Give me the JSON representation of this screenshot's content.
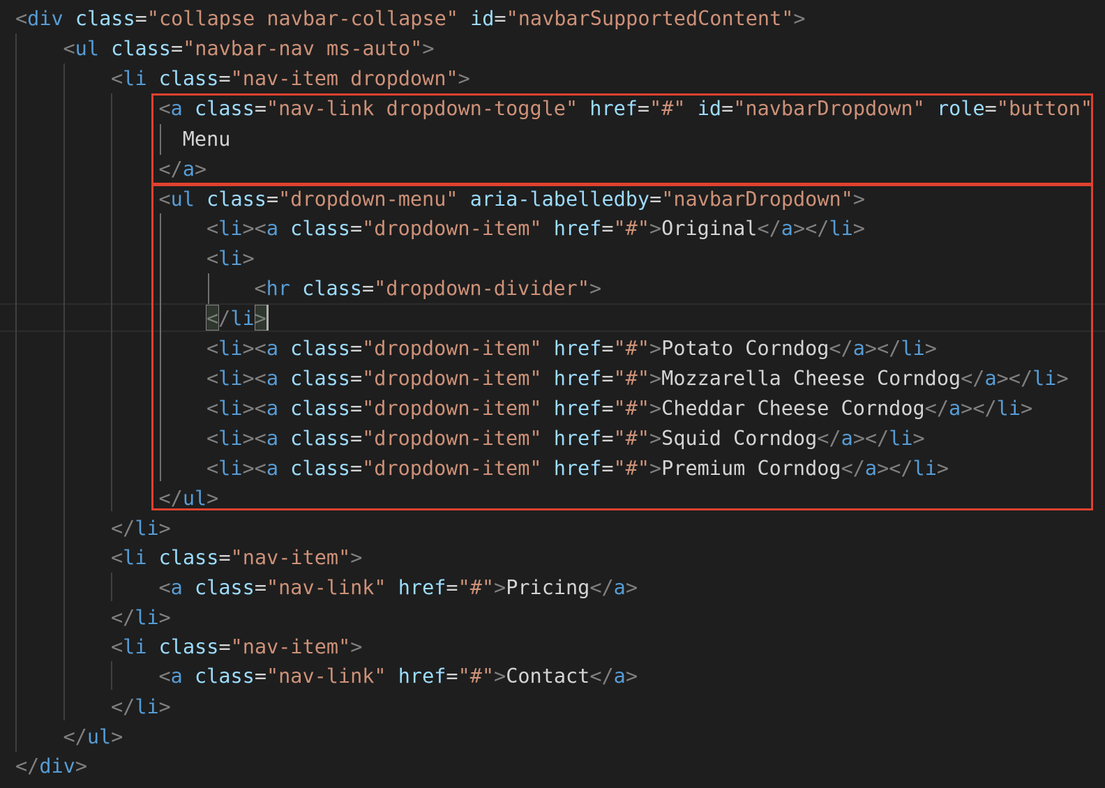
{
  "code": {
    "lines": [
      [
        [
          "p",
          "<"
        ],
        [
          "tg",
          "div"
        ],
        [
          "tx",
          " "
        ],
        [
          "at",
          "class"
        ],
        [
          "tx",
          "="
        ],
        [
          "st",
          "\"collapse navbar-collapse\""
        ],
        [
          "tx",
          " "
        ],
        [
          "at",
          "id"
        ],
        [
          "tx",
          "="
        ],
        [
          "st",
          "\"navbarSupportedContent\""
        ],
        [
          "p",
          ">"
        ]
      ],
      [
        [
          "p",
          "<"
        ],
        [
          "tg",
          "ul"
        ],
        [
          "tx",
          " "
        ],
        [
          "at",
          "class"
        ],
        [
          "tx",
          "="
        ],
        [
          "st",
          "\"navbar-nav ms-auto\""
        ],
        [
          "p",
          ">"
        ]
      ],
      [
        [
          "p",
          "<"
        ],
        [
          "tg",
          "li"
        ],
        [
          "tx",
          " "
        ],
        [
          "at",
          "class"
        ],
        [
          "tx",
          "="
        ],
        [
          "st",
          "\"nav-item dropdown\""
        ],
        [
          "p",
          ">"
        ]
      ],
      [
        [
          "p",
          "<"
        ],
        [
          "tg",
          "a"
        ],
        [
          "tx",
          " "
        ],
        [
          "at",
          "class"
        ],
        [
          "tx",
          "="
        ],
        [
          "st",
          "\"nav-link dropdown-toggle\""
        ],
        [
          "tx",
          " "
        ],
        [
          "at",
          "href"
        ],
        [
          "tx",
          "="
        ],
        [
          "st",
          "\"#\""
        ],
        [
          "tx",
          " "
        ],
        [
          "at",
          "id"
        ],
        [
          "tx",
          "="
        ],
        [
          "st",
          "\"navbarDropdown\""
        ],
        [
          "tx",
          " "
        ],
        [
          "at",
          "role"
        ],
        [
          "tx",
          "="
        ],
        [
          "st",
          "\"button\""
        ]
      ],
      [
        [
          "tx",
          "Menu"
        ]
      ],
      [
        [
          "p",
          "</"
        ],
        [
          "tg",
          "a"
        ],
        [
          "p",
          ">"
        ]
      ],
      [
        [
          "p",
          "<"
        ],
        [
          "tg",
          "ul"
        ],
        [
          "tx",
          " "
        ],
        [
          "at",
          "class"
        ],
        [
          "tx",
          "="
        ],
        [
          "st",
          "\"dropdown-menu\""
        ],
        [
          "tx",
          " "
        ],
        [
          "at",
          "aria-labelledby"
        ],
        [
          "tx",
          "="
        ],
        [
          "st",
          "\"navbarDropdown\""
        ],
        [
          "p",
          ">"
        ]
      ],
      [
        [
          "p",
          "<"
        ],
        [
          "tg",
          "li"
        ],
        [
          "p",
          "><"
        ],
        [
          "tg",
          "a"
        ],
        [
          "tx",
          " "
        ],
        [
          "at",
          "class"
        ],
        [
          "tx",
          "="
        ],
        [
          "st",
          "\"dropdown-item\""
        ],
        [
          "tx",
          " "
        ],
        [
          "at",
          "href"
        ],
        [
          "tx",
          "="
        ],
        [
          "st",
          "\"#\""
        ],
        [
          "p",
          ">"
        ],
        [
          "tx",
          "Original"
        ],
        [
          "p",
          "</"
        ],
        [
          "tg",
          "a"
        ],
        [
          "p",
          "></"
        ],
        [
          "tg",
          "li"
        ],
        [
          "p",
          ">"
        ]
      ],
      [
        [
          "p",
          "<"
        ],
        [
          "tg",
          "li"
        ],
        [
          "p",
          ">"
        ]
      ],
      [
        [
          "p",
          "<"
        ],
        [
          "tg",
          "hr"
        ],
        [
          "tx",
          " "
        ],
        [
          "at",
          "class"
        ],
        [
          "tx",
          "="
        ],
        [
          "st",
          "\"dropdown-divider\""
        ],
        [
          "p",
          ">"
        ]
      ],
      [
        [
          "p",
          "</"
        ],
        [
          "tg",
          "li"
        ],
        [
          "p",
          ">"
        ]
      ],
      [
        [
          "p",
          "<"
        ],
        [
          "tg",
          "li"
        ],
        [
          "p",
          "><"
        ],
        [
          "tg",
          "a"
        ],
        [
          "tx",
          " "
        ],
        [
          "at",
          "class"
        ],
        [
          "tx",
          "="
        ],
        [
          "st",
          "\"dropdown-item\""
        ],
        [
          "tx",
          " "
        ],
        [
          "at",
          "href"
        ],
        [
          "tx",
          "="
        ],
        [
          "st",
          "\"#\""
        ],
        [
          "p",
          ">"
        ],
        [
          "tx",
          "Potato Corndog"
        ],
        [
          "p",
          "</"
        ],
        [
          "tg",
          "a"
        ],
        [
          "p",
          "></"
        ],
        [
          "tg",
          "li"
        ],
        [
          "p",
          ">"
        ]
      ],
      [
        [
          "p",
          "<"
        ],
        [
          "tg",
          "li"
        ],
        [
          "p",
          "><"
        ],
        [
          "tg",
          "a"
        ],
        [
          "tx",
          " "
        ],
        [
          "at",
          "class"
        ],
        [
          "tx",
          "="
        ],
        [
          "st",
          "\"dropdown-item\""
        ],
        [
          "tx",
          " "
        ],
        [
          "at",
          "href"
        ],
        [
          "tx",
          "="
        ],
        [
          "st",
          "\"#\""
        ],
        [
          "p",
          ">"
        ],
        [
          "tx",
          "Mozzarella Cheese Corndog"
        ],
        [
          "p",
          "</"
        ],
        [
          "tg",
          "a"
        ],
        [
          "p",
          "></"
        ],
        [
          "tg",
          "li"
        ],
        [
          "p",
          ">"
        ]
      ],
      [
        [
          "p",
          "<"
        ],
        [
          "tg",
          "li"
        ],
        [
          "p",
          "><"
        ],
        [
          "tg",
          "a"
        ],
        [
          "tx",
          " "
        ],
        [
          "at",
          "class"
        ],
        [
          "tx",
          "="
        ],
        [
          "st",
          "\"dropdown-item\""
        ],
        [
          "tx",
          " "
        ],
        [
          "at",
          "href"
        ],
        [
          "tx",
          "="
        ],
        [
          "st",
          "\"#\""
        ],
        [
          "p",
          ">"
        ],
        [
          "tx",
          "Cheddar Cheese Corndog"
        ],
        [
          "p",
          "</"
        ],
        [
          "tg",
          "a"
        ],
        [
          "p",
          "></"
        ],
        [
          "tg",
          "li"
        ],
        [
          "p",
          ">"
        ]
      ],
      [
        [
          "p",
          "<"
        ],
        [
          "tg",
          "li"
        ],
        [
          "p",
          "><"
        ],
        [
          "tg",
          "a"
        ],
        [
          "tx",
          " "
        ],
        [
          "at",
          "class"
        ],
        [
          "tx",
          "="
        ],
        [
          "st",
          "\"dropdown-item\""
        ],
        [
          "tx",
          " "
        ],
        [
          "at",
          "href"
        ],
        [
          "tx",
          "="
        ],
        [
          "st",
          "\"#\""
        ],
        [
          "p",
          ">"
        ],
        [
          "tx",
          "Squid Corndog"
        ],
        [
          "p",
          "</"
        ],
        [
          "tg",
          "a"
        ],
        [
          "p",
          "></"
        ],
        [
          "tg",
          "li"
        ],
        [
          "p",
          ">"
        ]
      ],
      [
        [
          "p",
          "<"
        ],
        [
          "tg",
          "li"
        ],
        [
          "p",
          "><"
        ],
        [
          "tg",
          "a"
        ],
        [
          "tx",
          " "
        ],
        [
          "at",
          "class"
        ],
        [
          "tx",
          "="
        ],
        [
          "st",
          "\"dropdown-item\""
        ],
        [
          "tx",
          " "
        ],
        [
          "at",
          "href"
        ],
        [
          "tx",
          "="
        ],
        [
          "st",
          "\"#\""
        ],
        [
          "p",
          ">"
        ],
        [
          "tx",
          "Premium Corndog"
        ],
        [
          "p",
          "</"
        ],
        [
          "tg",
          "a"
        ],
        [
          "p",
          "></"
        ],
        [
          "tg",
          "li"
        ],
        [
          "p",
          ">"
        ]
      ],
      [
        [
          "p",
          "</"
        ],
        [
          "tg",
          "ul"
        ],
        [
          "p",
          ">"
        ]
      ],
      [
        [
          "p",
          "</"
        ],
        [
          "tg",
          "li"
        ],
        [
          "p",
          ">"
        ]
      ],
      [
        [
          "p",
          "<"
        ],
        [
          "tg",
          "li"
        ],
        [
          "tx",
          " "
        ],
        [
          "at",
          "class"
        ],
        [
          "tx",
          "="
        ],
        [
          "st",
          "\"nav-item\""
        ],
        [
          "p",
          ">"
        ]
      ],
      [
        [
          "p",
          "<"
        ],
        [
          "tg",
          "a"
        ],
        [
          "tx",
          " "
        ],
        [
          "at",
          "class"
        ],
        [
          "tx",
          "="
        ],
        [
          "st",
          "\"nav-link\""
        ],
        [
          "tx",
          " "
        ],
        [
          "at",
          "href"
        ],
        [
          "tx",
          "="
        ],
        [
          "st",
          "\"#\""
        ],
        [
          "p",
          ">"
        ],
        [
          "tx",
          "Pricing"
        ],
        [
          "p",
          "</"
        ],
        [
          "tg",
          "a"
        ],
        [
          "p",
          ">"
        ]
      ],
      [
        [
          "p",
          "</"
        ],
        [
          "tg",
          "li"
        ],
        [
          "p",
          ">"
        ]
      ],
      [
        [
          "p",
          "<"
        ],
        [
          "tg",
          "li"
        ],
        [
          "tx",
          " "
        ],
        [
          "at",
          "class"
        ],
        [
          "tx",
          "="
        ],
        [
          "st",
          "\"nav-item\""
        ],
        [
          "p",
          ">"
        ]
      ],
      [
        [
          "p",
          "<"
        ],
        [
          "tg",
          "a"
        ],
        [
          "tx",
          " "
        ],
        [
          "at",
          "class"
        ],
        [
          "tx",
          "="
        ],
        [
          "st",
          "\"nav-link\""
        ],
        [
          "tx",
          " "
        ],
        [
          "at",
          "href"
        ],
        [
          "tx",
          "="
        ],
        [
          "st",
          "\"#\""
        ],
        [
          "p",
          ">"
        ],
        [
          "tx",
          "Contact"
        ],
        [
          "p",
          "</"
        ],
        [
          "tg",
          "a"
        ],
        [
          "p",
          ">"
        ]
      ],
      [
        [
          "p",
          "</"
        ],
        [
          "tg",
          "li"
        ],
        [
          "p",
          ">"
        ]
      ],
      [
        [
          "p",
          "</"
        ],
        [
          "tg",
          "ul"
        ],
        [
          "p",
          ">"
        ]
      ],
      [
        [
          "p",
          "</"
        ],
        [
          "tg",
          "div"
        ],
        [
          "p",
          ">"
        ]
      ]
    ]
  },
  "colors": {
    "background": "#1e1e1e",
    "punctuation": "#808080",
    "tag": "#569cd6",
    "attribute": "#9cdcfe",
    "string": "#ce9178",
    "text": "#d4d4d4",
    "highlight_border": "#e0412f"
  }
}
